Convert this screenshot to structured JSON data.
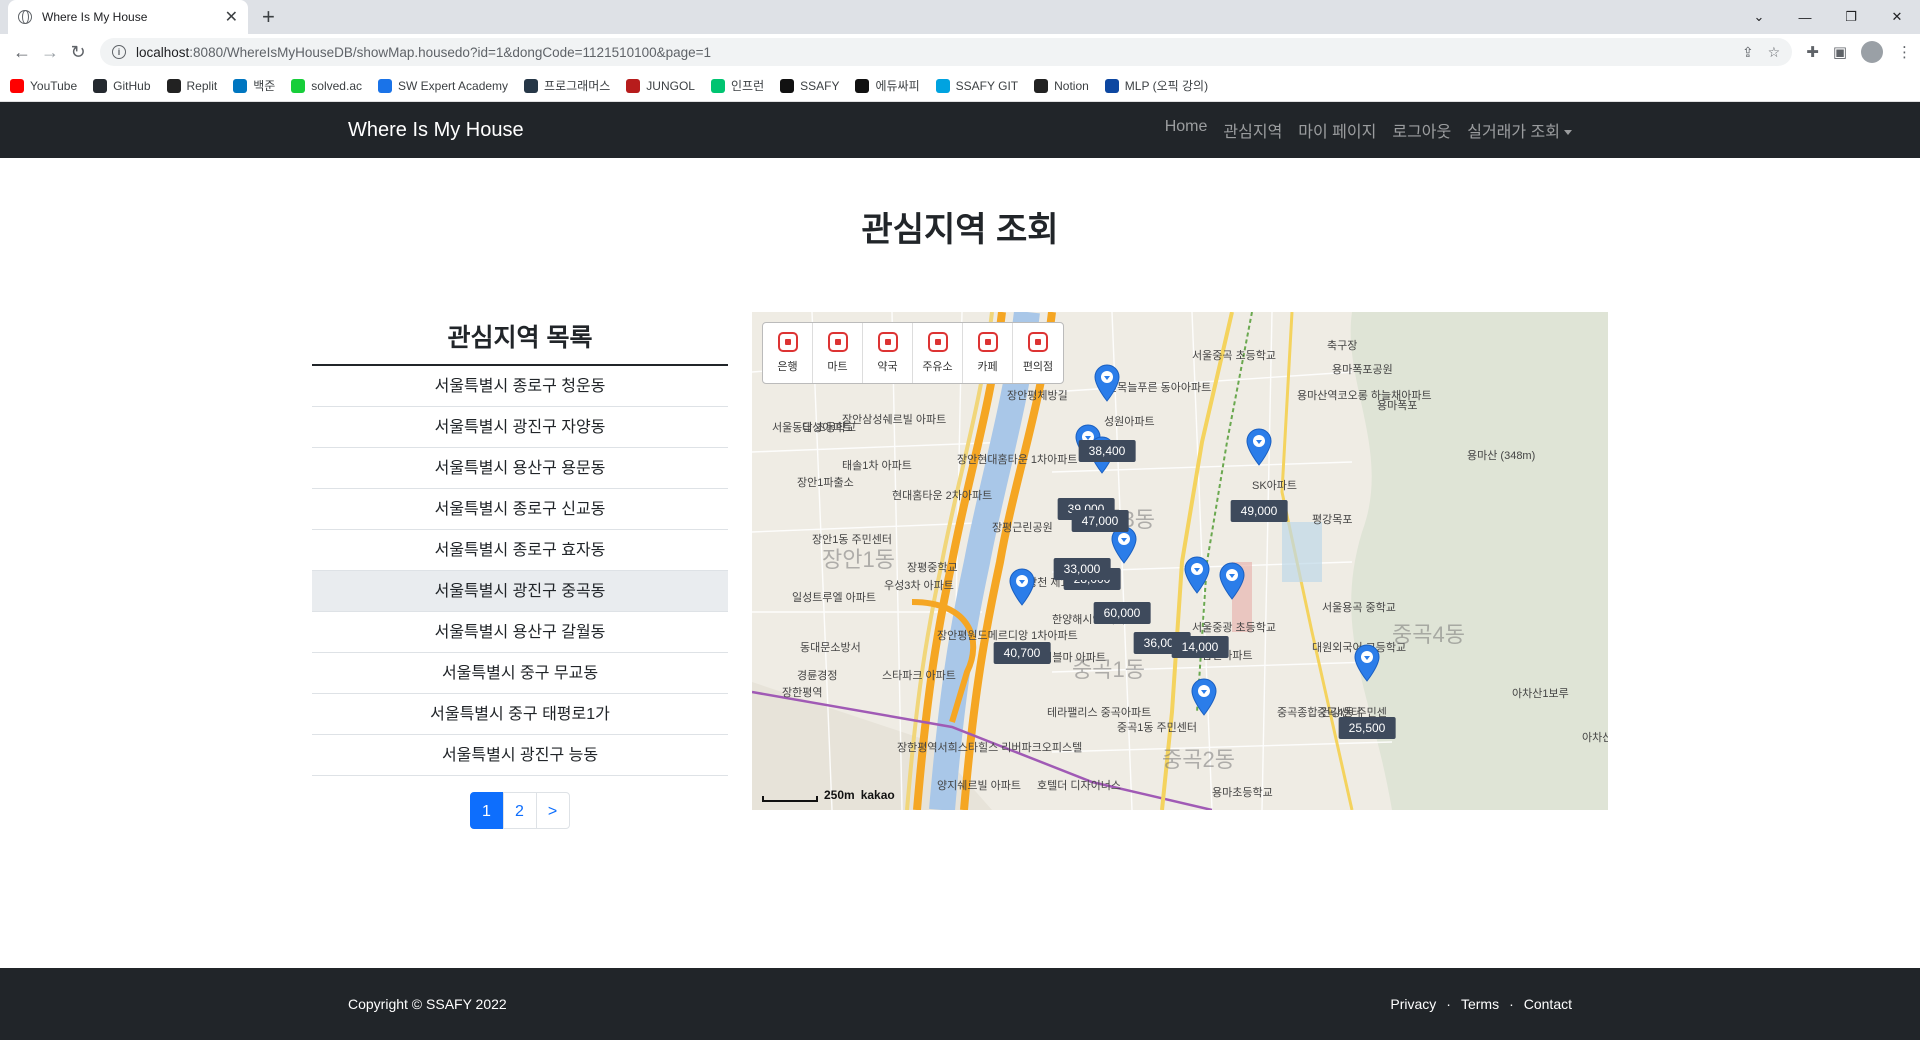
{
  "browser": {
    "tab_title": "Where Is My House",
    "url_host": "localhost",
    "url_rest": ":8080/WhereIsMyHouseDB/showMap.housedo?id=1&dongCode=1121510100&page=1",
    "bookmarks": [
      {
        "label": "YouTube",
        "color": "#ff0000"
      },
      {
        "label": "GitHub",
        "color": "#24292f"
      },
      {
        "label": "Replit",
        "color": "#222222"
      },
      {
        "label": "백준",
        "color": "#0076c0"
      },
      {
        "label": "solved.ac",
        "color": "#17ce3a"
      },
      {
        "label": "SW Expert Academy",
        "color": "#1a73e8"
      },
      {
        "label": "프로그래머스",
        "color": "#263747"
      },
      {
        "label": "JUNGOL",
        "color": "#b71c1c"
      },
      {
        "label": "인프런",
        "color": "#00c471"
      },
      {
        "label": "SSAFY",
        "color": "#111111"
      },
      {
        "label": "에듀싸피",
        "color": "#111111"
      },
      {
        "label": "SSAFY GIT",
        "color": "#00a3e0"
      },
      {
        "label": "Notion",
        "color": "#222222"
      },
      {
        "label": "MLP (오픽 강의)",
        "color": "#0d47a1"
      }
    ]
  },
  "nav": {
    "brand": "Where Is My House",
    "links": [
      "Home",
      "관심지역",
      "마이 페이지",
      "로그아웃",
      "실거래가 조회"
    ]
  },
  "page_title": "관심지역 조회",
  "list": {
    "heading": "관심지역 목록",
    "items": [
      "서울특별시 종로구 청운동",
      "서울특별시 광진구 자양동",
      "서울특별시 용산구 용문동",
      "서울특별시 종로구 신교동",
      "서울특별시 종로구 효자동",
      "서울특별시 광진구 중곡동",
      "서울특별시 용산구 갈월동",
      "서울특별시 중구 무교동",
      "서울특별시 중구 태평로1가",
      "서울특별시 광진구 능동"
    ],
    "active_index": 5,
    "pagination": [
      "1",
      "2",
      ">"
    ]
  },
  "map": {
    "categories": [
      "은행",
      "마트",
      "약국",
      "주유소",
      "카페",
      "편의점"
    ],
    "prices": [
      "38,400",
      "39,000",
      "47,000",
      "28,000",
      "60,000",
      "49,000",
      "40,700",
      "36,000",
      "14,000",
      "25,500",
      "33,000"
    ],
    "scale": "250m",
    "provider": "kakao",
    "dong_names": [
      "중곡3동",
      "중곡1동",
      "중곡4동",
      "중곡2동",
      "장안1동"
    ],
    "labels": [
      "장안평체방길",
      "성원아파트",
      "장안삼성쉐르빌 아파트",
      "대성아파트",
      "태솔1차 아파트",
      "장안현대홈타운 1차아파트",
      "현대홈타운 2차아파트",
      "장안1파출소",
      "장안1동 주민센터",
      "장평근린공원",
      "장평중학교",
      "우성3차 아파트",
      "일성트루엘 아파트",
      "중랑천 제1체육공원",
      "한양해시안 아파트",
      "장안평원드메르디앙 1차아파트",
      "동대문소방서",
      "경륜경정",
      "스타파크 아파트",
      "진흥더블마 아파트",
      "테라팰리스 중곡아파트",
      "장한평역서희스타힐스 리버파크오피스텔",
      "양지쉐르빌 아파트",
      "호텔더 디자이너스",
      "중곡1동 주민센터",
      "SK아파트",
      "평강목포",
      "서울중곡 초등학교",
      "면목늘푸른 동아아파트",
      "용마산역코오롱 하늘채아파트",
      "축구장",
      "용마폭포공원",
      "용마폭포",
      "용마산 (348m)",
      "서울용곡 중학교",
      "대원외국어 고등학교",
      "서울중광 초등학교",
      "삼민아파트",
      "중곡종합 건강센터",
      "중곡4동 주민센",
      "아차산1보루",
      "아차산 해맞이공원",
      "장한평역",
      "서울동답 초등학교",
      "용마초등학교"
    ]
  },
  "footer": {
    "copyright": "Copyright © SSAFY 2022",
    "links": [
      "Privacy",
      "Terms",
      "Contact"
    ],
    "separator": "·"
  }
}
